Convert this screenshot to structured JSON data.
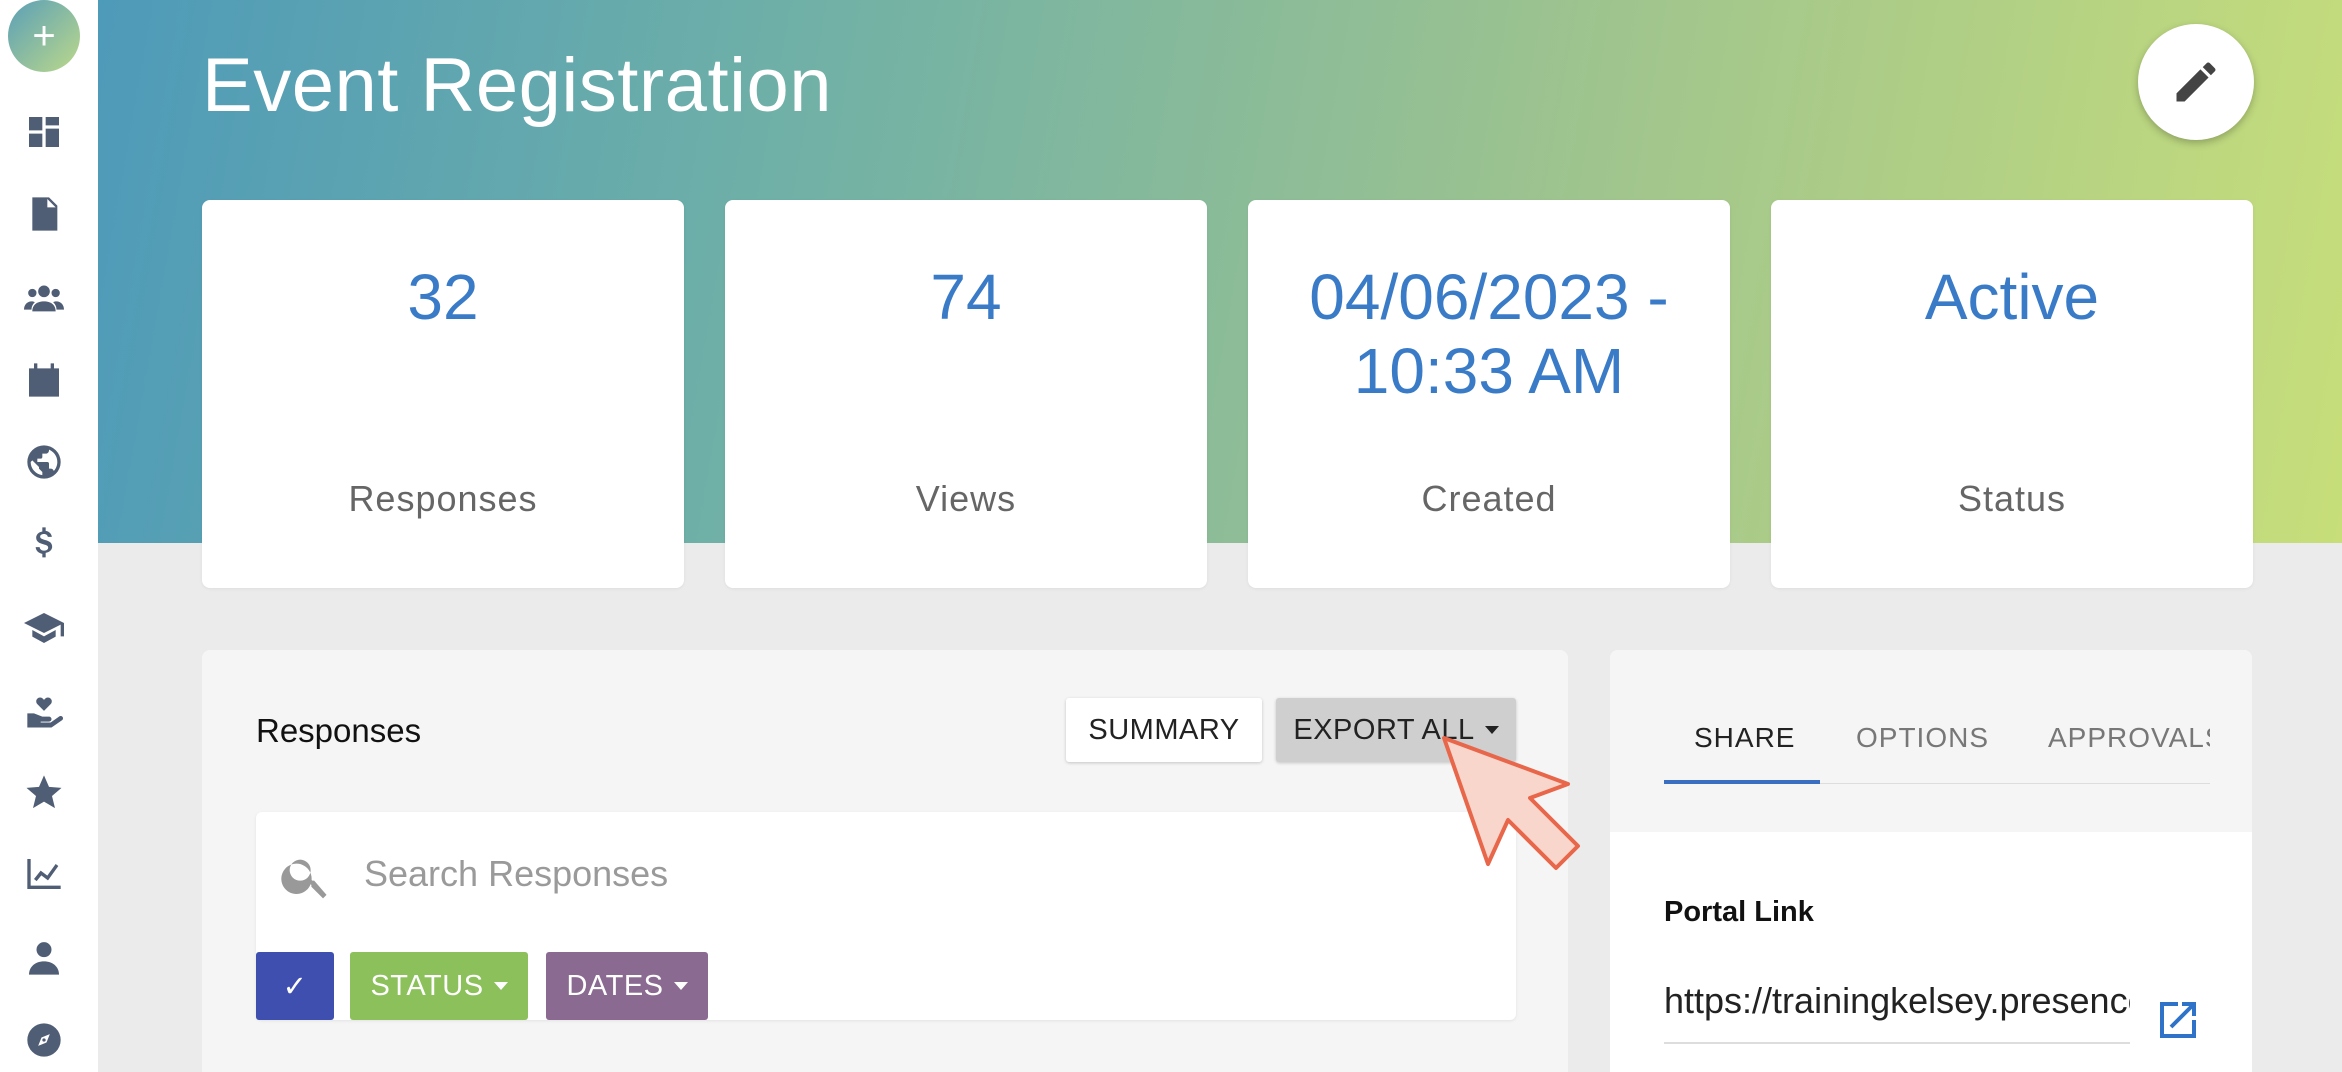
{
  "page": {
    "title": "Event Registration"
  },
  "sidebar": {
    "add_label": "+",
    "items": [
      {
        "icon": "dashboard-icon"
      },
      {
        "icon": "document-icon"
      },
      {
        "icon": "users-icon"
      },
      {
        "icon": "calendar-icon"
      },
      {
        "icon": "globe-icon"
      },
      {
        "icon": "dollar-icon"
      },
      {
        "icon": "graduation-cap-icon"
      },
      {
        "icon": "hand-heart-icon"
      },
      {
        "icon": "star-icon"
      },
      {
        "icon": "chart-icon"
      },
      {
        "icon": "user-icon"
      },
      {
        "icon": "compass-icon"
      }
    ]
  },
  "stats": [
    {
      "value": "32",
      "label": "Responses"
    },
    {
      "value": "74",
      "label": "Views"
    },
    {
      "value": "04/06/2023 - 10:33 AM",
      "label": "Created"
    },
    {
      "value": "Active",
      "label": "Status"
    }
  ],
  "responses": {
    "title": "Responses",
    "summary_label": "SUMMARY",
    "export_label": "EXPORT ALL",
    "search_placeholder": "Search Responses",
    "filters": {
      "check": "✓",
      "status": "STATUS",
      "dates": "DATES"
    }
  },
  "share": {
    "tabs": [
      "SHARE",
      "OPTIONS",
      "APPROVALS"
    ],
    "active_tab": "SHARE",
    "portal_label": "Portal Link",
    "portal_link": "https://trainingkelsey.presence.io"
  },
  "colors": {
    "accent": "#3a7bc8",
    "status_chip": "#8bc05a",
    "dates_chip": "#8b6a91",
    "check_chip": "#3f4fb0"
  }
}
